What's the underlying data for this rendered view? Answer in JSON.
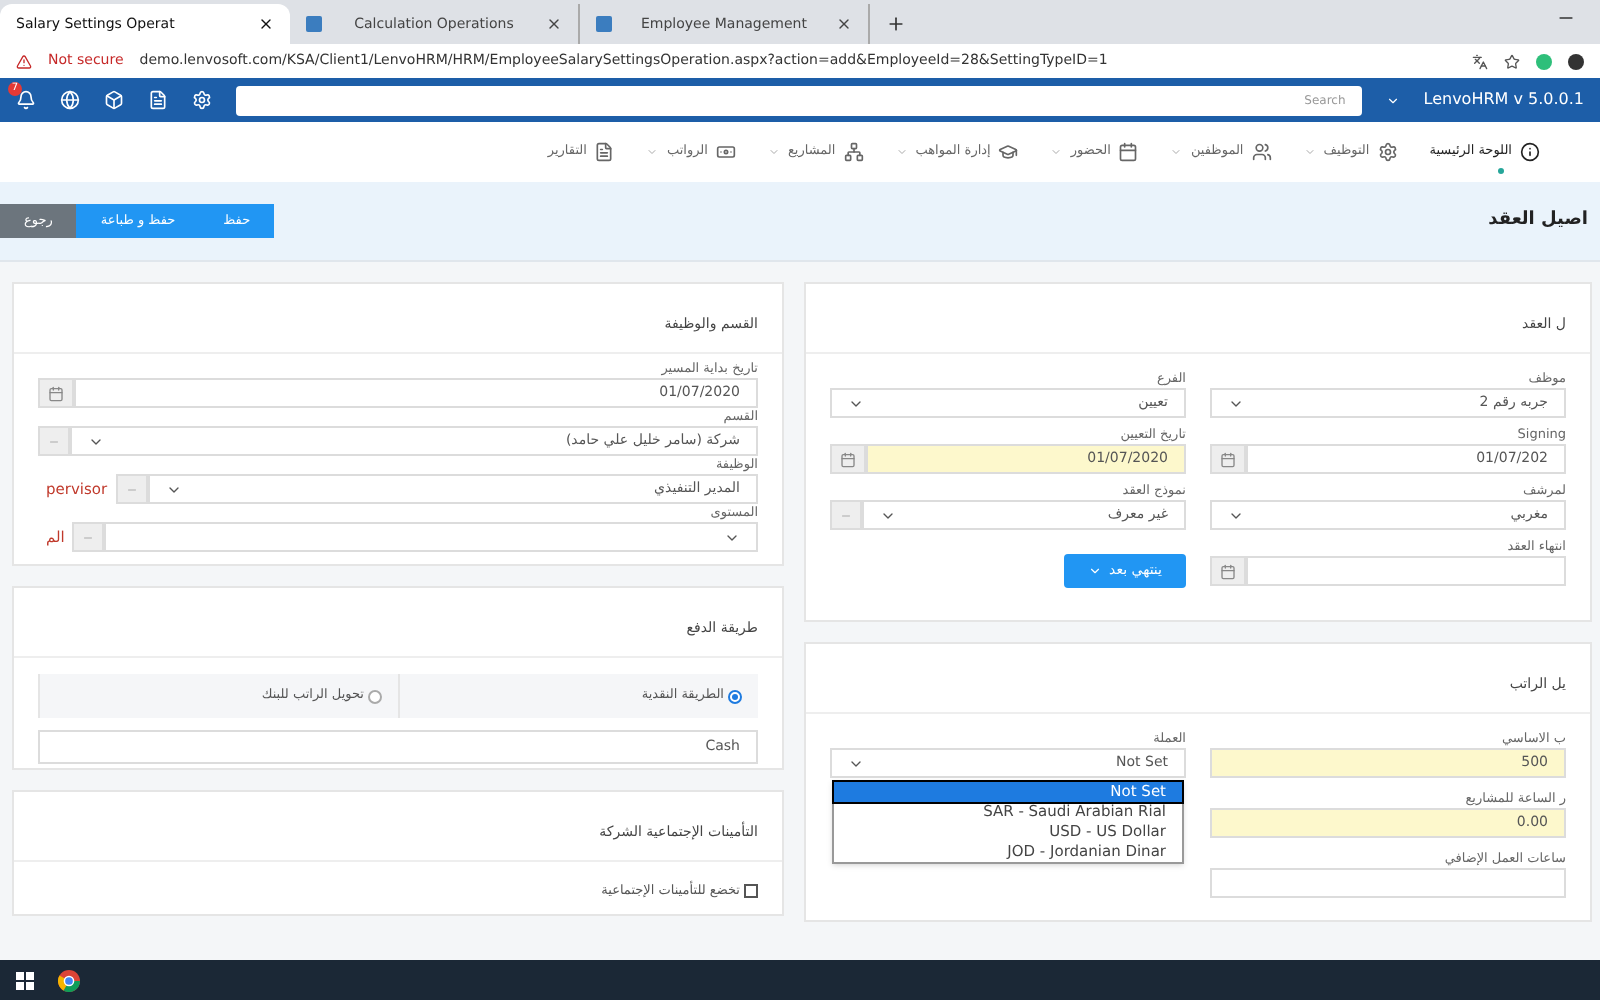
{
  "browser": {
    "tab_1": {
      "label": "Salary Settings Operat",
      "selected": true
    },
    "tab_2": {
      "label": "Calculation Operations",
      "selected": false
    },
    "tab_3": {
      "label": "Employee Management",
      "selected": false
    },
    "security": "Not secure",
    "url": "demo.lenvosoft.com/KSA/Client1/LenvoHRM/HRM/EmployeeSalarySettingsOperation.aspx?action=add&EmployeeId=28&SettingTypeID=1"
  },
  "header": {
    "badge": "7",
    "search_placeholder": "Search",
    "product": "LenvoHRM v 5.0.0.1"
  },
  "nav": [
    {
      "label": "اللوحة الرئيسية",
      "dropdown": false,
      "selected": true
    },
    {
      "label": "التوظيف",
      "dropdown": true,
      "selected": false
    },
    {
      "label": "الموظفين",
      "dropdown": true,
      "selected": false
    },
    {
      "label": "الحضور",
      "dropdown": true,
      "selected": false
    },
    {
      "label": "إدارة المواهب",
      "dropdown": true,
      "selected": false
    },
    {
      "label": "المشاريع",
      "dropdown": true,
      "selected": false
    },
    {
      "label": "الرواتب",
      "dropdown": true,
      "selected": false
    },
    {
      "label": "التقارير",
      "dropdown": false,
      "selected": false
    }
  ],
  "page_title": "اصيل العقد",
  "actions": [
    {
      "label": "حفظ",
      "kind": "primary"
    },
    {
      "label": "حفظ و طباعة",
      "kind": "primary"
    },
    {
      "label": "رجوع",
      "kind": "secondary"
    }
  ],
  "contract_panel": {
    "title": "ل العقد",
    "fields": [
      {
        "label": "موظف",
        "kind": "select",
        "value": "جربه رقم 2",
        "highlighted": false
      },
      {
        "label": "الفرع",
        "kind": "select",
        "value": "تعيين",
        "highlighted": false
      },
      {
        "label": "Signing",
        "kind": "date",
        "value": "01/07/202",
        "highlighted": false
      },
      {
        "label": "تاريخ التعيين",
        "kind": "date",
        "value": "01/07/2020",
        "highlighted": true
      },
      {
        "label": "لمرشف",
        "kind": "select",
        "value": "مغربي",
        "highlighted": false
      },
      {
        "label": "نموذج العقد",
        "kind": "select",
        "value": "غير معرف",
        "highlighted": false,
        "dash": true
      },
      {
        "label": "انتهاء العقد",
        "kind": "date",
        "highlighted": false
      },
      {
        "kind": "button",
        "value": "ينتهي بعد"
      }
    ]
  },
  "salary_panel": {
    "title": "يل الراتب",
    "fields": [
      {
        "label": "ب الاساسي",
        "kind": "text",
        "value": "500",
        "highlighted": true
      },
      {
        "label": "العملة",
        "kind": "select",
        "value": "Not Set",
        "highlighted": false,
        "open": true,
        "options": [
          {
            "label": "Not Set",
            "selected": true
          },
          {
            "label": "SAR - Saudi Arabian Rial",
            "selected": false
          },
          {
            "label": "USD - US Dollar",
            "selected": false
          },
          {
            "label": "JOD - Jordanian Dinar",
            "selected": false
          }
        ]
      },
      {
        "label": "ر الساعة للمشاريع",
        "kind": "text",
        "value": "0.00",
        "highlighted": true
      },
      {
        "kind": "empty"
      },
      {
        "label": "ساعات العمل الإضافي",
        "kind": "text",
        "highlighted": false
      }
    ]
  },
  "department_panel": {
    "title": "القسم والوظيفة",
    "fields": [
      {
        "label": "تاريخ بداية المسير",
        "kind": "date",
        "value": "01/07/2020",
        "highlighted": false
      },
      {
        "label": "القسم",
        "kind": "select",
        "value": "شركة (سامر خليل علي حامد)",
        "highlighted": false,
        "dash": true
      },
      {
        "label": "الوظيفة",
        "kind": "select",
        "value": "المدير التنفيذي",
        "highlighted": false,
        "dash": true,
        "tag": "pervisor"
      },
      {
        "label": "المستوى",
        "kind": "select",
        "highlighted": false,
        "dash": true,
        "tag": "الم"
      }
    ]
  },
  "payment_panel": {
    "title": "طريقة الدفع",
    "options": [
      {
        "label": "الطريقة النقدية",
        "selected": true
      },
      {
        "label": "تحويل الراتب للبنك",
        "selected": false
      }
    ],
    "value": "Cash"
  },
  "insurance_panel": {
    "title": "التأمينات الإجتماعية الشركة",
    "checkbox": {
      "label": "تخضع للتأمينات الإجتماعية",
      "checked": false
    }
  }
}
